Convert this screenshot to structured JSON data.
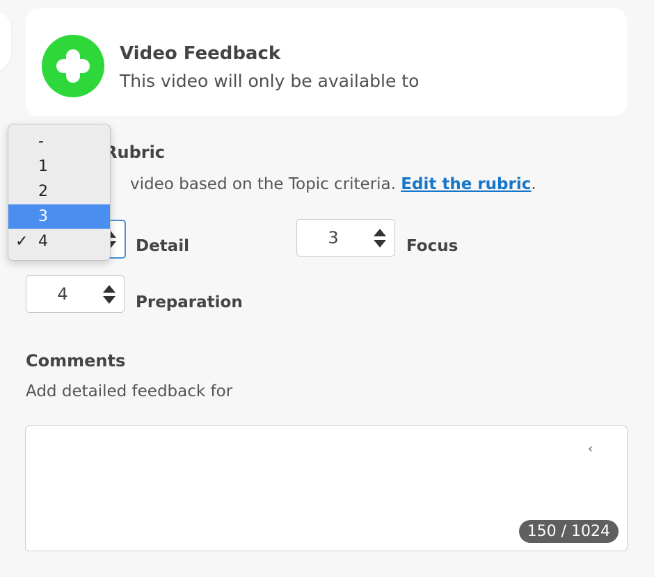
{
  "feedback": {
    "title": "Video Feedback",
    "subtitle": "This video will only be available to",
    "icon": "plus-circle-icon",
    "icon_color": "#2fd83a"
  },
  "rubric": {
    "title": "Rubric",
    "description": "video based on the Topic criteria.",
    "edit_link": "Edit the rubric",
    "trailing_period": ".",
    "link_color": "#1776c8",
    "criteria": [
      {
        "label": "Detail",
        "value": "4"
      },
      {
        "label": "Focus",
        "value": "3"
      },
      {
        "label": "Preparation",
        "value": "4"
      }
    ]
  },
  "dropdown": {
    "options": [
      "-",
      "1",
      "2",
      "3",
      "4"
    ],
    "highlighted": "3",
    "checked": "4",
    "check_glyph": "✓",
    "highlight_color": "#4a8ff0"
  },
  "comments": {
    "title": "Comments",
    "description": "Add detailed feedback for",
    "counter": "150 / 1024"
  }
}
